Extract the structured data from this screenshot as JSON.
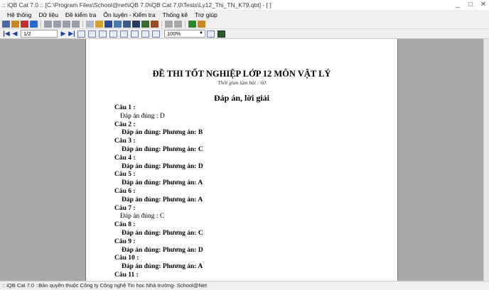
{
  "window": {
    "title": ":: iQB Cat 7.0 :: [C:\\Program Files\\School@net\\iQB 7.0\\iQB Cat 7.0\\Tests\\Ly12_Thi_TN_K79.qbt] - [ ]",
    "controls": [
      "_",
      "□",
      "✕"
    ]
  },
  "menu": {
    "items": [
      "Hệ thống",
      "Dữ liệu",
      "Đề kiểm tra",
      "Ôn luyện - Kiểm tra",
      "Thống kê",
      "Trợ giúp"
    ]
  },
  "toolbar1": {
    "icons": [
      {
        "name": "new-icon",
        "color": "#4a6aa8"
      },
      {
        "name": "open-icon",
        "color": "#c88a28"
      },
      {
        "name": "users-icon",
        "color": "#c03030"
      },
      {
        "name": "info-icon",
        "color": "#2a6ad0"
      },
      {
        "name": "sep"
      },
      {
        "name": "grid1-icon",
        "color": "#9aa0aa"
      },
      {
        "name": "grid2-icon",
        "color": "#9aa0aa"
      },
      {
        "name": "grid3-icon",
        "color": "#9aa0aa"
      },
      {
        "name": "grid4-icon",
        "color": "#9aa0aa"
      },
      {
        "name": "sep"
      },
      {
        "name": "doc-icon",
        "color": "#b0b8c8"
      },
      {
        "name": "folder-icon",
        "color": "#d8a030"
      },
      {
        "name": "save-icon",
        "color": "#2a4a90"
      },
      {
        "name": "edit-icon",
        "color": "#4a7ab0"
      },
      {
        "name": "preview-icon",
        "color": "#3a5a90"
      },
      {
        "name": "search-icon",
        "color": "#2a3a60"
      },
      {
        "name": "export-icon",
        "color": "#3a6a30"
      },
      {
        "name": "import-icon",
        "color": "#9a4a20"
      },
      {
        "name": "sep"
      },
      {
        "name": "report1-icon",
        "color": "#a8a8a8"
      },
      {
        "name": "report2-icon",
        "color": "#a8a8a8"
      },
      {
        "name": "sep"
      },
      {
        "name": "help-icon",
        "color": "#2a8a2a"
      },
      {
        "name": "tools-icon",
        "color": "#c88a28"
      }
    ]
  },
  "toolbar2": {
    "page_value": "1/2",
    "zoom_value": "100%"
  },
  "document": {
    "title": "ĐỀ THI TỐT NGHIỆP LỚP 12 MÔN VẬT LÝ",
    "time_label": "Thời gian làm bài : 60",
    "subtitle": "Đáp án, lời giải",
    "questions": [
      {
        "label": "Câu 1 :",
        "answer": "Đáp án đúng : D",
        "bold": false
      },
      {
        "label": "Câu 2 :",
        "answer": "Đáp án đúng: Phương án: B",
        "bold": true
      },
      {
        "label": "Câu 3 :",
        "answer": "Đáp án đúng: Phương án: C",
        "bold": true
      },
      {
        "label": "Câu 4 :",
        "answer": "Đáp án đúng: Phương án: D",
        "bold": true
      },
      {
        "label": "Câu 5 :",
        "answer": "Đáp án đúng: Phương án: A",
        "bold": true
      },
      {
        "label": "Câu 6 :",
        "answer": "Đáp án đúng: Phương án: A",
        "bold": true
      },
      {
        "label": "Câu 7 :",
        "answer": "Đáp án đúng : C",
        "bold": false
      },
      {
        "label": "Câu 8 :",
        "answer": "Đáp án đúng: Phương án: C",
        "bold": true
      },
      {
        "label": "Câu 9 :",
        "answer": "Đáp án đúng: Phương án: D",
        "bold": true
      },
      {
        "label": "Câu 10 :",
        "answer": "Đáp án đúng: Phương án: A",
        "bold": true
      },
      {
        "label": "Câu 11 :",
        "answer": null,
        "bold": false
      }
    ]
  },
  "status": {
    "text": ":: iQB Cat 7.0 ::Bản quyền thuộc Công ty Công nghệ Tin học Nhà trường- School@Net"
  }
}
